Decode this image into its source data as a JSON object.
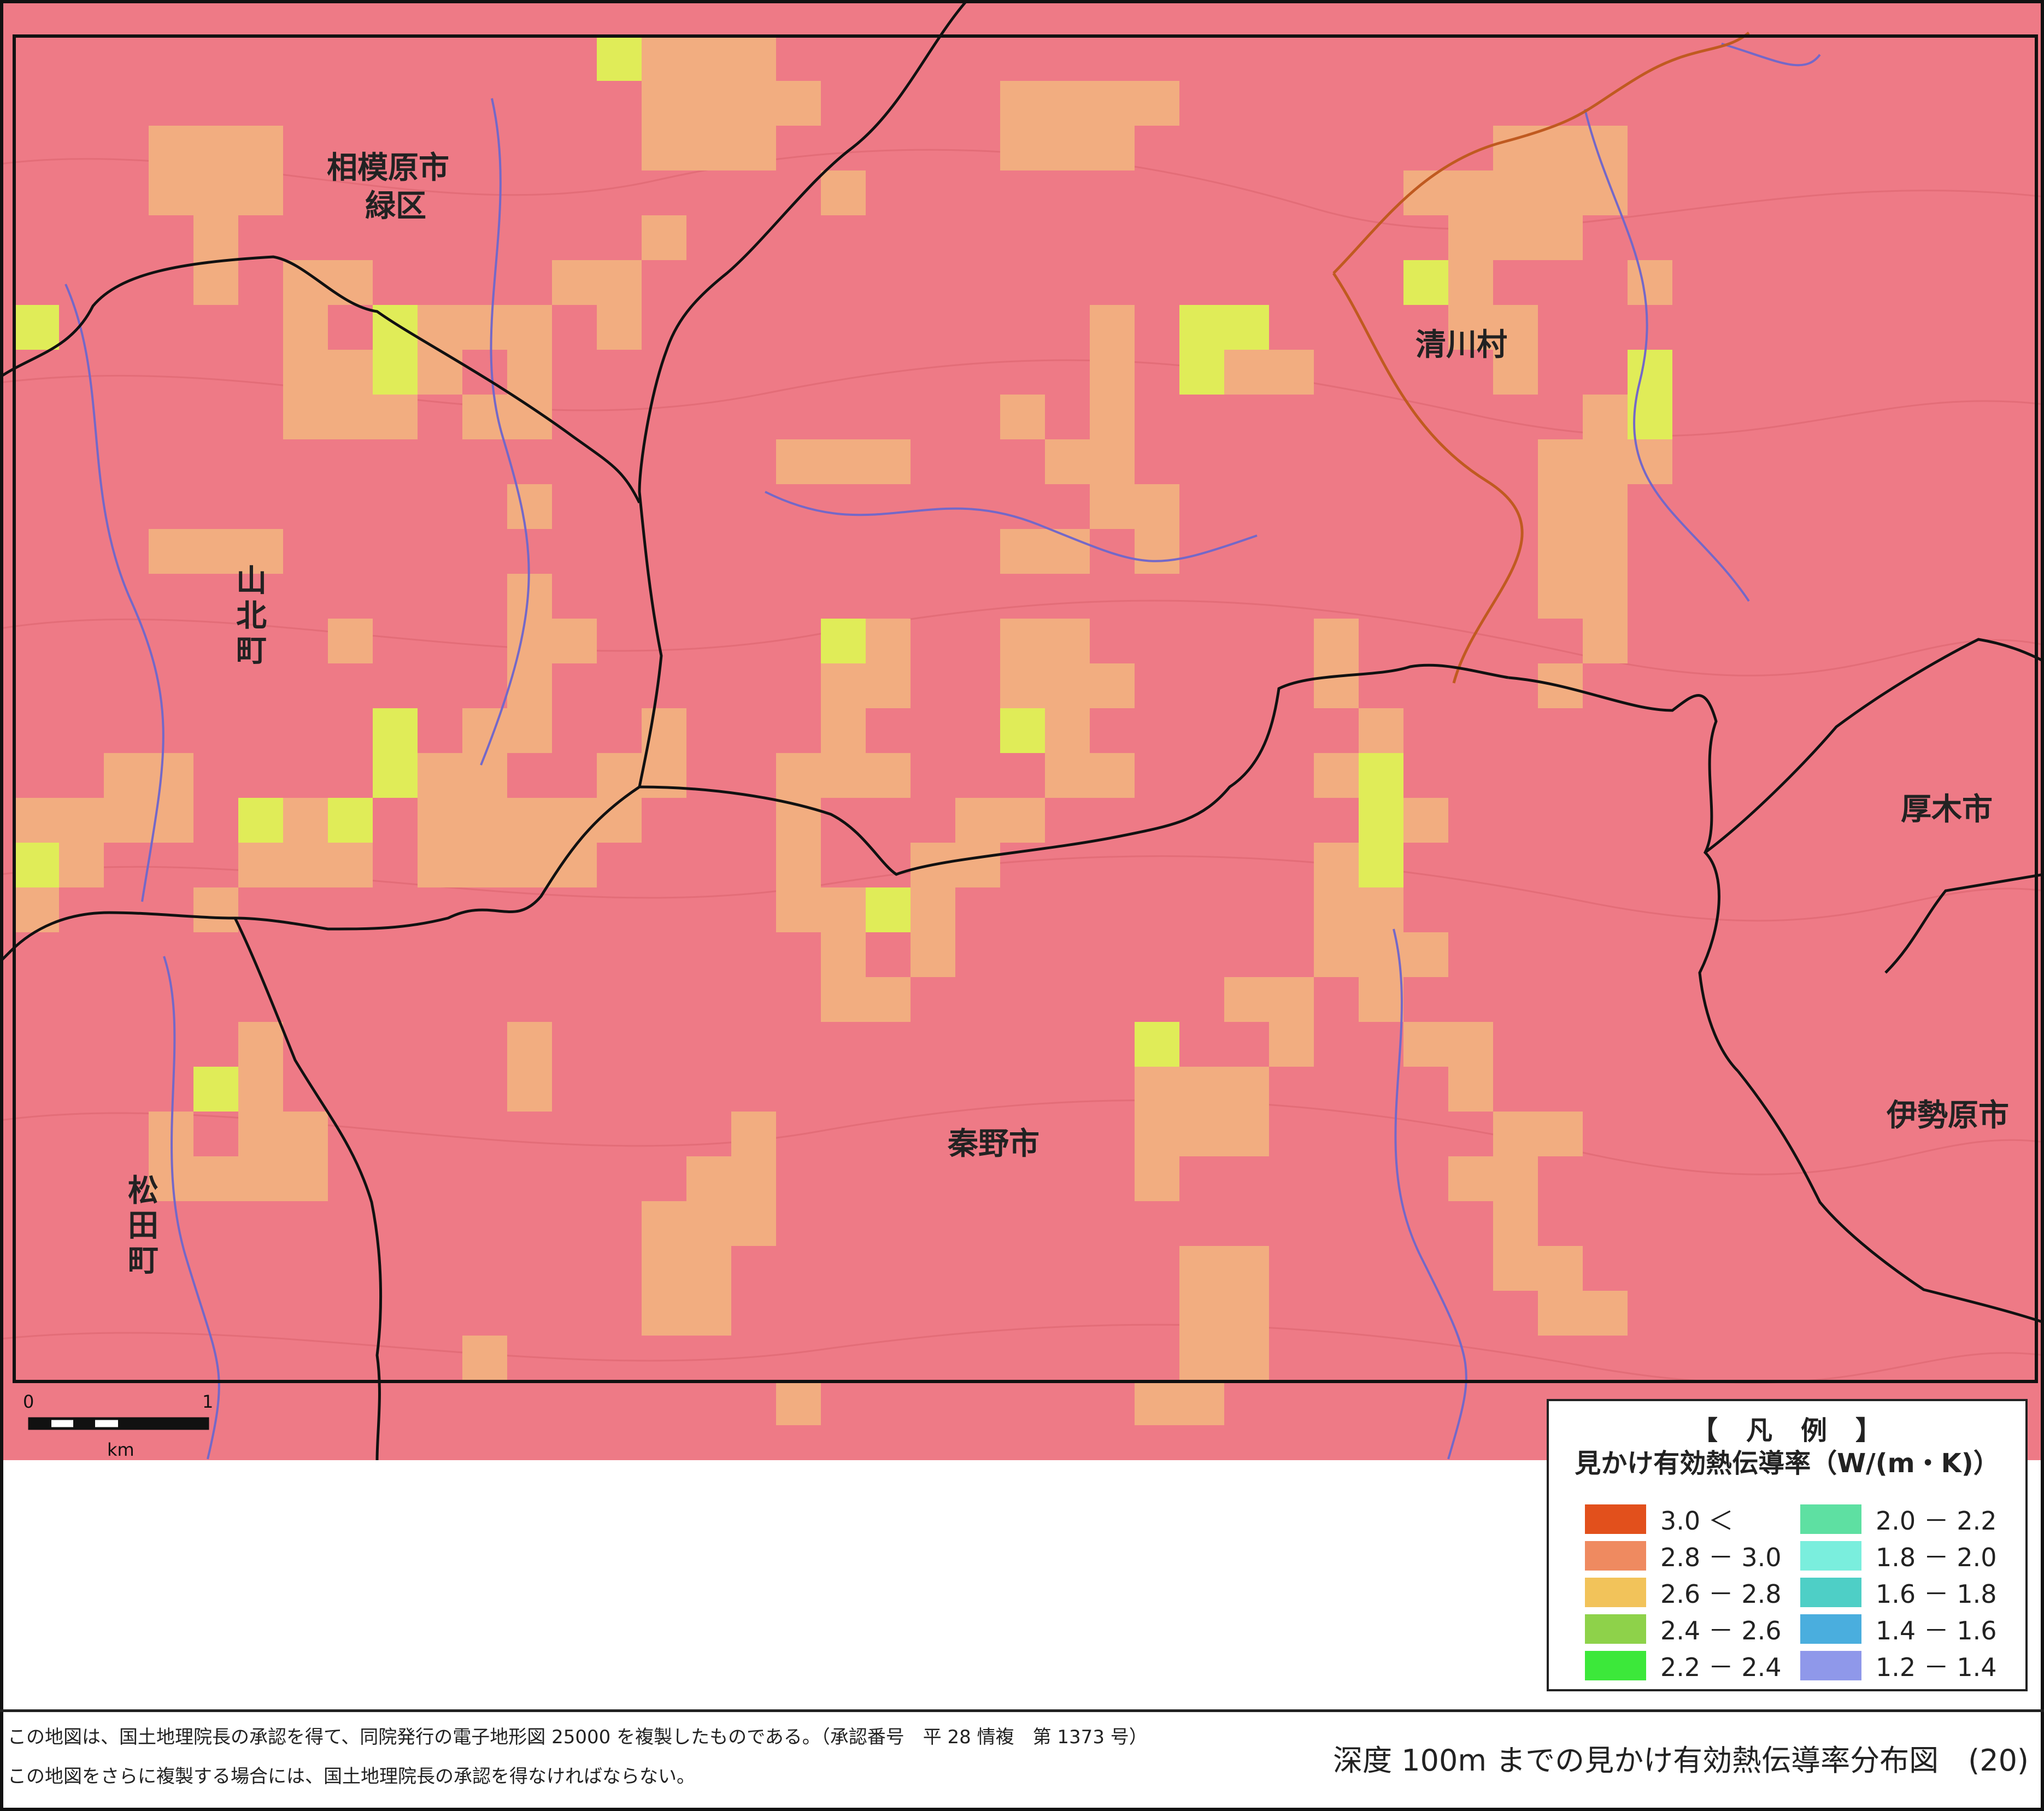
{
  "colors": {
    "base": "#ee7a86",
    "cell_2_6_2_8": "#f2ad80",
    "cell_2_4_2_6": "#e0ec58",
    "roads": "#111111",
    "rivers": "#7468c8"
  },
  "place_names": [
    {
      "id": "sagamihara",
      "label": "相模原市"
    },
    {
      "id": "midori-ku",
      "label": "緑区"
    },
    {
      "id": "kiyokawa",
      "label": "清川村"
    },
    {
      "id": "yamakita-1",
      "label": "山"
    },
    {
      "id": "yamakita-2",
      "label": "北"
    },
    {
      "id": "yamakita-3",
      "label": "町"
    },
    {
      "id": "atsugi",
      "label": "厚木市"
    },
    {
      "id": "isehara",
      "label": "伊勢原市"
    },
    {
      "id": "hadano",
      "label": "秦野市"
    },
    {
      "id": "matsuda-1",
      "label": "松"
    },
    {
      "id": "matsuda-2",
      "label": "田"
    },
    {
      "id": "matsuda-3",
      "label": "町"
    }
  ],
  "scale_bar": {
    "start": "0",
    "end": "1",
    "unit": "km"
  },
  "legend": {
    "title": "【　凡　例　】",
    "subtitle": "見かけ有効熱伝導率（W/(m・K)）",
    "items": [
      {
        "label": "3.0 ＜",
        "color": "#e2501c"
      },
      {
        "label": "2.8 － 3.0",
        "color": "#ef8a60"
      },
      {
        "label": "2.6 － 2.8",
        "color": "#f2c35a"
      },
      {
        "label": "2.4 － 2.6",
        "color": "#8ed24a"
      },
      {
        "label": "2.2 － 2.4",
        "color": "#3ce83a"
      },
      {
        "label": "2.0 － 2.2",
        "color": "#5ee0a2"
      },
      {
        "label": "1.8 － 2.0",
        "color": "#7aeedd"
      },
      {
        "label": "1.6 － 1.8",
        "color": "#4ecfc6"
      },
      {
        "label": "1.4 － 1.6",
        "color": "#4aaede"
      },
      {
        "label": "1.2 － 1.4",
        "color": "#8f98ea"
      }
    ]
  },
  "footer": {
    "note1": "この地図は、国土地理院長の承認を得て、同院発行の電子地形図 25000 を複製したものである。（承認番号　平 28 情複　第 1373 号）",
    "note2": "この地図をさらに複製する場合には、国土地理院長の承認を得なければならない。",
    "figure_title": "深度 100m までの見かけ有効熱伝導率分布図　(20)"
  }
}
